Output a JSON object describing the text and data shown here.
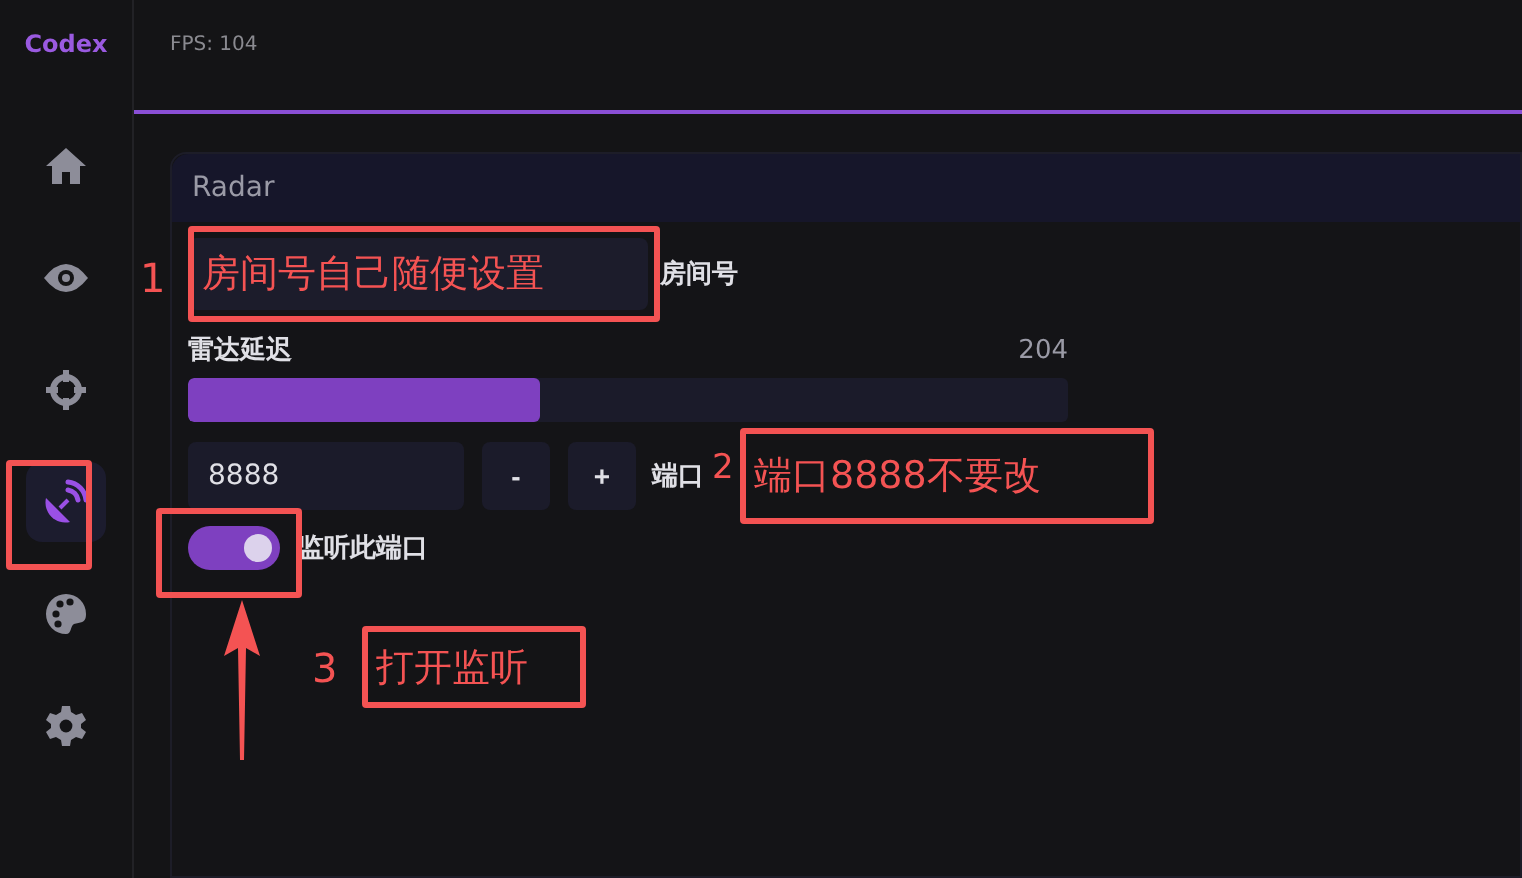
{
  "app_name": "Codex",
  "fps": "FPS: 104",
  "nav": [
    {
      "selected": false
    },
    {
      "selected": false
    },
    {
      "selected": false
    },
    {
      "selected": true
    },
    {
      "selected": false
    },
    {
      "selected": false
    }
  ],
  "panel": {
    "title": "Radar",
    "room_label": "房间号",
    "delay": {
      "label": "雷达延迟",
      "reading": "204",
      "level": 0.4
    },
    "port": {
      "value": "8888",
      "minus": "-",
      "plus": "+",
      "label": "端口"
    },
    "listen": {
      "on": true,
      "label": "监听此端口"
    }
  },
  "annotations": [
    {
      "number": "1",
      "text": "房间号自己随便设置"
    },
    {
      "number": "2",
      "text": "端口8888不要改"
    },
    {
      "number": "3",
      "text": "打开监听"
    }
  ]
}
